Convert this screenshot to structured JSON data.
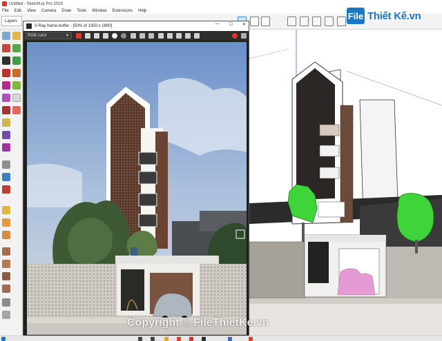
{
  "window": {
    "title": "Untitled - SketchUp Pro 2019"
  },
  "menu": [
    "File",
    "Edit",
    "View",
    "Camera",
    "Draw",
    "Tools",
    "Window",
    "Extensions",
    "Help"
  ],
  "toolbar": {
    "layers_label": "Layers"
  },
  "watermark": {
    "badge": "File",
    "brand": "Thiết Kế.vn",
    "copyright": "Copyright © FileThietKe.vn"
  },
  "vfb": {
    "title": "V-Ray frame buffer - [50% of 1350 x 1800]",
    "channel": "RGB color",
    "win_min": "—",
    "win_max": "☐",
    "win_close": "✕"
  },
  "colors": {
    "brand": "#1c77c3",
    "viewport_bg": "#ffffff",
    "vfb_bg": "#1f1f1f",
    "tree_green": "#3fd43a",
    "car_pink": "#e59ad4"
  }
}
